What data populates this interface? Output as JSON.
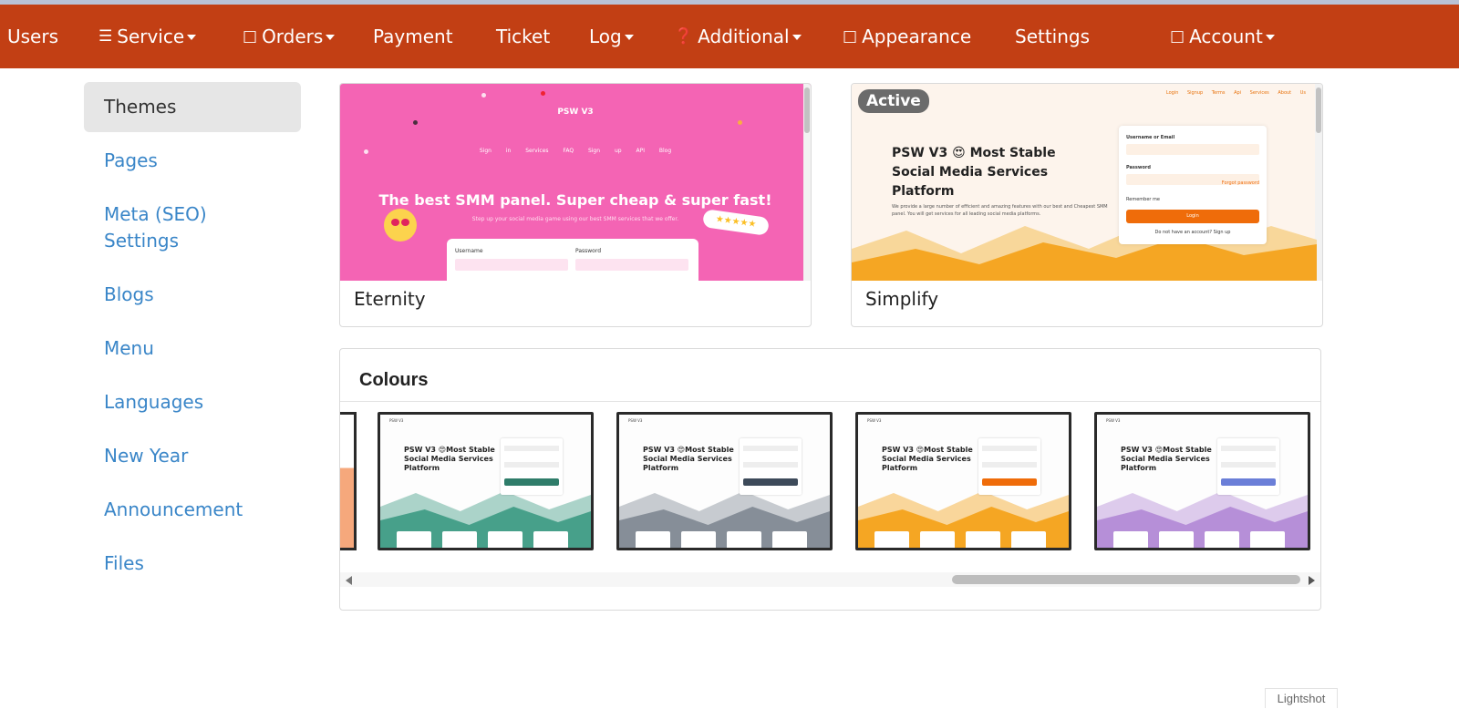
{
  "navbar": {
    "items": [
      {
        "label": "Users",
        "icon": "",
        "caret": false
      },
      {
        "label": "Service",
        "icon": "list-icon",
        "caret": true
      },
      {
        "label": "Orders",
        "icon": "missing-glyph",
        "caret": true
      },
      {
        "label": "Payment",
        "icon": "",
        "caret": false
      },
      {
        "label": "Ticket",
        "icon": "",
        "caret": false
      },
      {
        "label": "Log",
        "icon": "",
        "caret": true
      },
      {
        "label": "Additional",
        "icon": "question-circle-icon",
        "caret": true
      },
      {
        "label": "Appearance",
        "icon": "missing-glyph",
        "caret": false
      },
      {
        "label": "Settings",
        "icon": "",
        "caret": false
      },
      {
        "label": "Account",
        "icon": "missing-glyph",
        "caret": true
      }
    ],
    "background": "#c23f14"
  },
  "sidebar": {
    "items": [
      {
        "label": "Themes",
        "active": true
      },
      {
        "label": "Pages",
        "active": false
      },
      {
        "label": "Meta (SEO) Settings",
        "active": false
      },
      {
        "label": "Blogs",
        "active": false
      },
      {
        "label": "Menu",
        "active": false
      },
      {
        "label": "Languages",
        "active": false
      },
      {
        "label": "New Year",
        "active": false
      },
      {
        "label": "Announcement",
        "active": false
      },
      {
        "label": "Files",
        "active": false
      }
    ],
    "link_color": "#3a86c8"
  },
  "themes": [
    {
      "name": "Eternity",
      "active": false,
      "preview": {
        "logo": "PSW V3",
        "links": "Sign in Services FAQ Sign up API Blog",
        "hero": "The best SMM panel. Super cheap & super fast!",
        "sub": "Step up your social media game using our best SMM services that we offer.",
        "username_label": "Username",
        "password_label": "Password",
        "color": "#f464b4"
      }
    },
    {
      "name": "Simplify",
      "active": true,
      "active_label": "Active",
      "preview": {
        "nav": "Login Signup Terms Api Services About Us",
        "headline": "PSW V3 😍 Most Stable Social Media Services Platform",
        "desc": "We provide a large number of efficient and amazing features with our best and Cheapest SMM panel. You will get services for all leading social media platforms.",
        "username_label": "Username or Email",
        "password_label": "Password",
        "forgot": "Forgot password",
        "remember": "Remember me",
        "login": "Login",
        "no_account": "Do not have an account? Sign up",
        "color": "#f5a623"
      }
    }
  ],
  "colours": {
    "title": "Colours",
    "swatches": [
      {
        "name": "green",
        "color": "#47a08a",
        "headline": "PSW V3 😍Most Stable Social Media Services Platform",
        "header": "PSW V3"
      },
      {
        "name": "grey",
        "color": "#868e98",
        "headline": "PSW V3 😍Most Stable Social Media Services Platform",
        "header": "PSW V3"
      },
      {
        "name": "orange",
        "color": "#f5a623",
        "headline": "PSW V3 😍Most Stable Social Media Services Platform",
        "header": "PSW V3"
      },
      {
        "name": "purple",
        "color": "#b68fd8",
        "headline": "PSW V3 😍Most Stable Social Media Services Platform",
        "header": "PSW V3"
      }
    ]
  },
  "footer": {
    "lightshot": "Lightshot"
  }
}
